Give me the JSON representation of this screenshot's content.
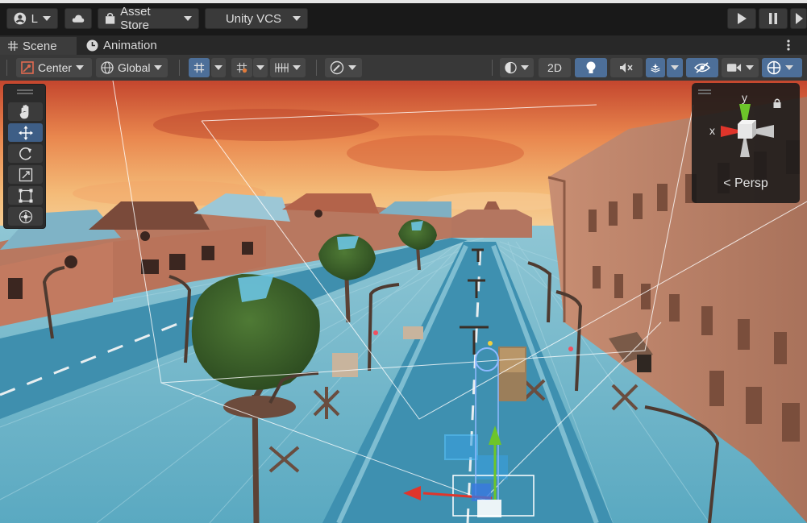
{
  "toolbar": {
    "account": "L",
    "asset_store": "Asset Store",
    "vcs": "Unity VCS"
  },
  "tabs": [
    {
      "label": "Scene"
    },
    {
      "label": "Animation"
    }
  ],
  "scene_toolbar": {
    "pivot": "Center",
    "space": "Global",
    "mode_2d": "2D"
  },
  "gizmo": {
    "y_label": "y",
    "x_label": "x",
    "projection": "Persp"
  },
  "colors": {
    "selection": "#3e5e86",
    "x_axis": "#e0352b",
    "y_axis": "#6dc52a",
    "z_axis": "#3a78e0"
  }
}
